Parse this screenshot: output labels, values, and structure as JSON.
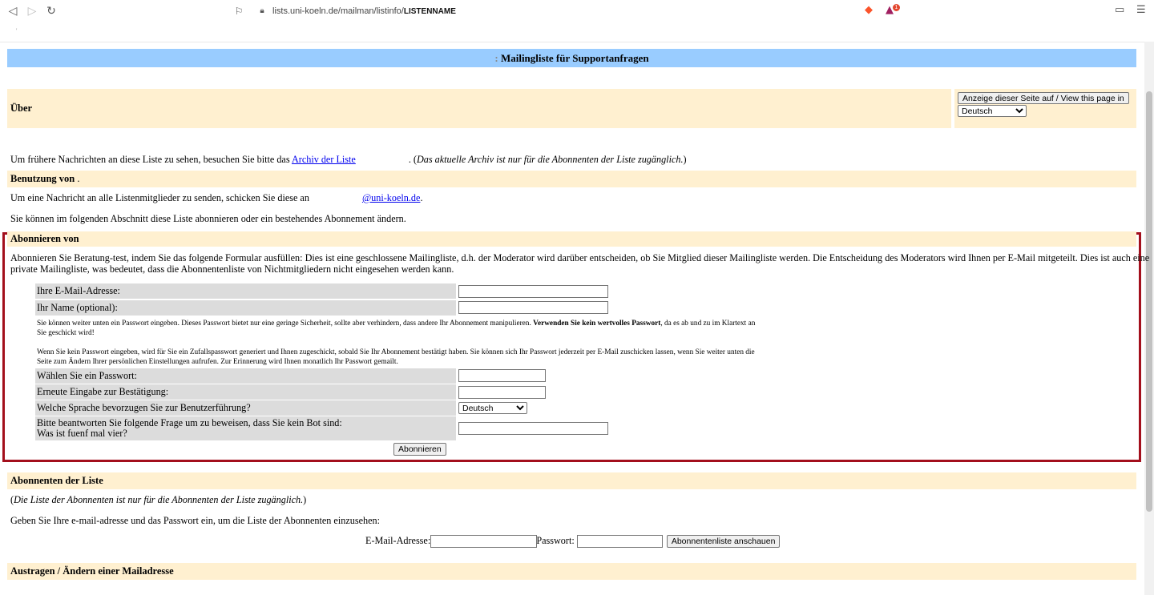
{
  "browser": {
    "url_prefix": "lists.uni-koeln.de/mailman/listinfo/",
    "url_list": "LISTENNAME",
    "badge": "1"
  },
  "header": {
    "title": "Mailingliste für Supportanfragen"
  },
  "about": {
    "label": "Über",
    "view_button": "Anzeige dieser Seite auf / View this page in",
    "language": "Deutsch"
  },
  "archive": {
    "text_before": "Um frühere Nachrichten an diese Liste zu sehen, besuchen Sie bitte das ",
    "link": "Archiv der Liste",
    "text_after": ". (",
    "note": "Das aktuelle Archiv ist nur für die Abonnenten der Liste zugänglich.",
    "close": ")"
  },
  "usage": {
    "heading": "Benutzung von",
    "heading_suffix": " .",
    "send_text": "Um eine Nachricht an alle Listenmitglieder zu senden, schicken Sie diese an",
    "email_link": "@uni-koeln.de",
    "period": ".",
    "subscribe_info": "Sie können im folgenden Abschnitt diese Liste abonnieren oder ein bestehendes Abonnement ändern."
  },
  "subscribe": {
    "heading": "Abonnieren von",
    "intro1": "Abonnieren Sie Beratung-test, indem Sie das folgende Formular ausfüllen: Dies ist eine geschlossene Mailingliste, d.h. der Moderator wird darüber entscheiden, ob Sie Mitglied dieser Mailingliste werden. Die Entscheidung des Moderators wird Ihnen per E-Mail mitgeteilt. Dies ist auch eine",
    "intro2": "private Mailingliste, was bedeutet, dass die Abonnentenliste von Nichtmitgliedern nicht eingesehen werden kann.",
    "email_label": "Ihre E-Mail-Adresse:",
    "name_label": "Ihr Name (optional):",
    "pw_note1_a": "Sie können weiter unten ein Passwort eingeben. Dieses Passwort bietet nur eine geringe Sicherheit, sollte aber verhindern, dass andere Ihr Abonnement manipulieren. ",
    "pw_note1_b": "Verwenden Sie kein wertvolles Passwort",
    "pw_note1_c": ", da es ab und zu im Klartext an",
    "pw_note1_d": "Sie geschickt wird!",
    "pw_note2_a": "Wenn Sie kein Passwort eingeben, wird für Sie ein Zufallspasswort generiert und Ihnen zugeschickt, sobald Sie Ihr Abonnement bestätigt haben. Sie können sich Ihr Passwort jederzeit per E-Mail zuschicken lassen, wenn Sie weiter unten die",
    "pw_note2_b": "Seite zum Ändern Ihrer persönlichen Einstellungen aufrufen. Zur Erinnerung wird Ihnen monatlich Ihr Passwort gemailt.",
    "pw_label": "Wählen Sie ein Passwort:",
    "pw_confirm_label": "Erneute Eingabe zur Bestätigung:",
    "lang_label": "Welche Sprache bevorzugen Sie zur Benutzerführung?",
    "lang_value": "Deutsch",
    "bot_label1": "Bitte beantworten Sie folgende Frage um zu beweisen, dass Sie kein Bot sind:",
    "bot_label2": "Was ist fuenf mal vier?",
    "submit": "Abonnieren"
  },
  "subscribers": {
    "heading": "Abonnenten der Liste",
    "note_open": "(",
    "note": "Die Liste der Abonnenten ist nur für die Abonnenten der Liste zugänglich.",
    "note_close": ")",
    "instructions": "Geben Sie Ihre e-mail-adresse und das Passwort ein, um die Liste der Abonnenten einzusehen:",
    "email_label": "E-Mail-Adresse:",
    "pw_label": "Passwort:",
    "button": "Abonnentenliste anschauen"
  },
  "unsubscribe": {
    "heading": "Austragen / Ändern einer Mailadresse"
  }
}
